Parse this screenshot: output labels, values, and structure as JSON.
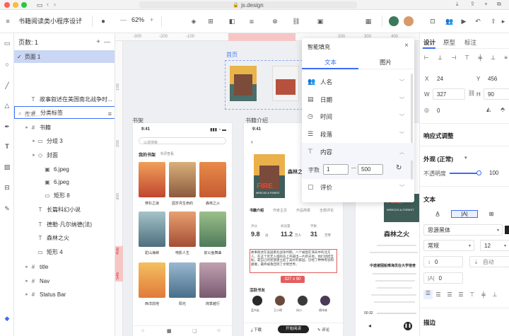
{
  "browser": {
    "url": "js.design",
    "colors": {
      "close": "#ff5f57",
      "min": "#febc2e",
      "max": "#28c840"
    }
  },
  "toolbar": {
    "project_name": "书籍阅读类小程序设计",
    "zoom": "62%"
  },
  "layers_panel": {
    "pages_label": "页数: 1",
    "page_item": "页面 1",
    "search_placeholder": "搜索...",
    "items": [
      {
        "label": "故事叙述在美国南北战争时...",
        "icon": "T",
        "indent": 0
      },
      {
        "label": "分类标签",
        "icon": "#",
        "indent": 0
      },
      {
        "label": "书籍",
        "icon": "#",
        "indent": 0
      },
      {
        "label": "分组 3",
        "icon": "▭",
        "indent": 1
      },
      {
        "label": "封面",
        "icon": "◇",
        "indent": 1
      },
      {
        "label": "6.jpeg",
        "icon": "▣",
        "indent": 2
      },
      {
        "label": "6.jpeg",
        "icon": "▣",
        "indent": 2
      },
      {
        "label": "矩形 8",
        "icon": "▭",
        "indent": 2
      },
      {
        "label": "长篇科幻小说",
        "icon": "T",
        "indent": 1
      },
      {
        "label": "德勒·凡尔纳德(法)",
        "icon": "T",
        "indent": 1
      },
      {
        "label": "森林之火",
        "icon": "T",
        "indent": 1
      },
      {
        "label": "矩形 4",
        "icon": "▭",
        "indent": 1
      },
      {
        "label": "title",
        "icon": "#",
        "indent": 0
      },
      {
        "label": "Nav",
        "icon": "#",
        "indent": 0
      },
      {
        "label": "Status Bar",
        "icon": "#",
        "indent": 0
      }
    ]
  },
  "canvas": {
    "ruler_h": [
      "-300",
      "-200",
      "-100",
      "100",
      "200",
      "300",
      "400"
    ],
    "ruler_v": [
      "100",
      "200",
      "300",
      "456",
      "546"
    ],
    "frame_homepage": "首页",
    "frame_bookshelf": "书架",
    "frame_bookintro": "书籍介绍",
    "phone1": {
      "time": "9:41",
      "search": "以诺搜索",
      "tab_active": "我的书架",
      "tab_other": "书评查看",
      "books": [
        "穿衫之浪",
        "因岁月生命的",
        "森林之火",
        "驼山海峡",
        "电影人生",
        "前公鱼舞曲",
        "西洋前地",
        "阳光",
        "岗季越行"
      ]
    },
    "phone2": {
      "time": "9:41",
      "book_title": "森林之火",
      "cover_title": "FIRE",
      "cover_sub": "WRECKS & FOREST",
      "tabs": [
        "书籍介绍",
        "作家主页",
        "作品简章",
        "全部评论"
      ],
      "stats": [
        {
          "label": "评分",
          "value": "9.8",
          "unit": "分"
        },
        {
          "label": "阅读量",
          "value": "11.2",
          "unit": "万人"
        },
        {
          "label": "字数",
          "value": "31",
          "unit": "万字"
        }
      ],
      "desc": "故事叙述在美国南北战争时期，八个被困在海岛中的北方人，在这个荒无人烟的岛上开辟出一片新天地，他们团结互助，靠自己的智慧建立起了美好的家园，历经了种种考验和磨难，最终被救回到了文明世界。",
      "selection_size": "327 x 90",
      "friends_label": "活跃书友",
      "friends": [
        "蓝书友",
        "王小明",
        "向小",
        "德伟林"
      ],
      "bottom": [
        "下载",
        "开始阅读",
        "评论"
      ]
    },
    "phone3": {
      "title": "森林之火",
      "time_start": "00:32",
      "line1": "中途被困船难海员在大学宿舍",
      "cover_title": "FIRE",
      "cover_sub": "WRECKS & FOREST"
    }
  },
  "smart_fill": {
    "title": "智能填充",
    "tab_text": "文本",
    "tab_image": "图片",
    "items": [
      {
        "label": "人名",
        "icon": "person-icon"
      },
      {
        "label": "日期",
        "icon": "calendar-icon"
      },
      {
        "label": "时间",
        "icon": "clock-icon"
      },
      {
        "label": "段落",
        "icon": "paragraph-icon"
      },
      {
        "label": "内容",
        "icon": "content-icon"
      },
      {
        "label": "评价",
        "icon": "rating-icon"
      }
    ],
    "word_count_label": "字数",
    "min": "1",
    "dash": "—",
    "max": "500"
  },
  "properties": {
    "tabs": [
      "设计",
      "原型",
      "标注"
    ],
    "x_label": "X",
    "x": "24",
    "y_label": "Y",
    "y": "456",
    "w_label": "W",
    "w": "327",
    "h_label": "H",
    "h": "90",
    "rotation": "0",
    "responsive": "响应式调整",
    "appearance": "外观 (正常)",
    "opacity_label": "不透明度",
    "opacity": "100",
    "text_section": "文本",
    "font": "思源黑体",
    "weight": "常规",
    "size": "12",
    "line_height": "0",
    "auto": "自动",
    "letter_spacing": "0",
    "stroke": "描边",
    "accent": "#3b6cf6"
  }
}
